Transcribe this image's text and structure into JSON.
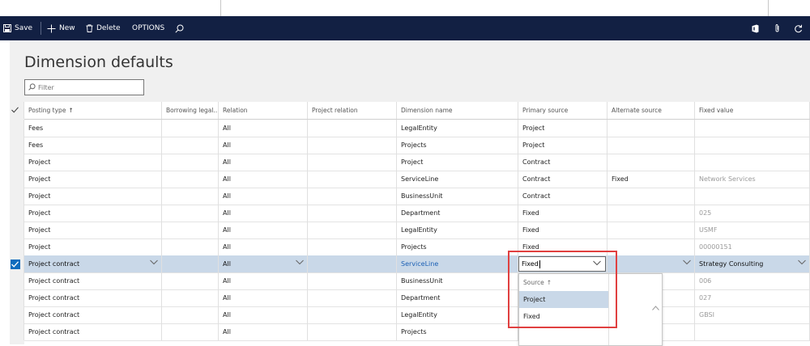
{
  "toolbar": {
    "save": "Save",
    "new": "New",
    "delete": "Delete",
    "options": "OPTIONS"
  },
  "page": {
    "title": "Dimension defaults",
    "filter_placeholder": "Filter"
  },
  "grid": {
    "columns": [
      "Posting type",
      "Borrowing legal...",
      "Relation",
      "Project relation",
      "Dimension name",
      "Primary source",
      "Alternate source",
      "Fixed value"
    ],
    "sort_indicator": "↑",
    "rows": [
      {
        "posting": "Fees",
        "borrowing": "",
        "relation": "All",
        "project_relation": "",
        "dimension": "LegalEntity",
        "primary": "Project",
        "alternate": "",
        "fixed": ""
      },
      {
        "posting": "Fees",
        "borrowing": "",
        "relation": "All",
        "project_relation": "",
        "dimension": "Projects",
        "primary": "Project",
        "alternate": "",
        "fixed": ""
      },
      {
        "posting": "Project",
        "borrowing": "",
        "relation": "All",
        "project_relation": "",
        "dimension": "Project",
        "primary": "Contract",
        "alternate": "",
        "fixed": ""
      },
      {
        "posting": "Project",
        "borrowing": "",
        "relation": "All",
        "project_relation": "",
        "dimension": "ServiceLine",
        "primary": "Contract",
        "alternate": "Fixed",
        "fixed": "Network Services"
      },
      {
        "posting": "Project",
        "borrowing": "",
        "relation": "All",
        "project_relation": "",
        "dimension": "BusinessUnit",
        "primary": "Contract",
        "alternate": "",
        "fixed": ""
      },
      {
        "posting": "Project",
        "borrowing": "",
        "relation": "All",
        "project_relation": "",
        "dimension": "Department",
        "primary": "Fixed",
        "alternate": "",
        "fixed": "025"
      },
      {
        "posting": "Project",
        "borrowing": "",
        "relation": "All",
        "project_relation": "",
        "dimension": "LegalEntity",
        "primary": "Fixed",
        "alternate": "",
        "fixed": "USMF"
      },
      {
        "posting": "Project",
        "borrowing": "",
        "relation": "All",
        "project_relation": "",
        "dimension": "Projects",
        "primary": "Fixed",
        "alternate": "",
        "fixed": "00000151"
      },
      {
        "posting": "Project contract",
        "borrowing": "",
        "relation": "All",
        "project_relation": "",
        "dimension": "ServiceLine",
        "primary": "Fixed",
        "alternate": "",
        "fixed": "Strategy Consulting"
      },
      {
        "posting": "Project contract",
        "borrowing": "",
        "relation": "All",
        "project_relation": "",
        "dimension": "BusinessUnit",
        "primary": "",
        "alternate": "",
        "fixed": "006"
      },
      {
        "posting": "Project contract",
        "borrowing": "",
        "relation": "All",
        "project_relation": "",
        "dimension": "Department",
        "primary": "",
        "alternate": "",
        "fixed": "027"
      },
      {
        "posting": "Project contract",
        "borrowing": "",
        "relation": "All",
        "project_relation": "",
        "dimension": "LegalEntity",
        "primary": "",
        "alternate": "",
        "fixed": "GBSI"
      },
      {
        "posting": "Project contract",
        "borrowing": "",
        "relation": "All",
        "project_relation": "",
        "dimension": "Projects",
        "primary": "",
        "alternate": "",
        "fixed": ""
      }
    ]
  },
  "dropdown": {
    "header": "Source",
    "sort_indicator": "↑",
    "options": [
      "Project",
      "Fixed"
    ],
    "selected": "Project"
  },
  "colors": {
    "toolbar_bg": "#122043",
    "selected_row": "#c9d8e8",
    "highlight": "#e04040",
    "link": "#1a5fb4"
  }
}
